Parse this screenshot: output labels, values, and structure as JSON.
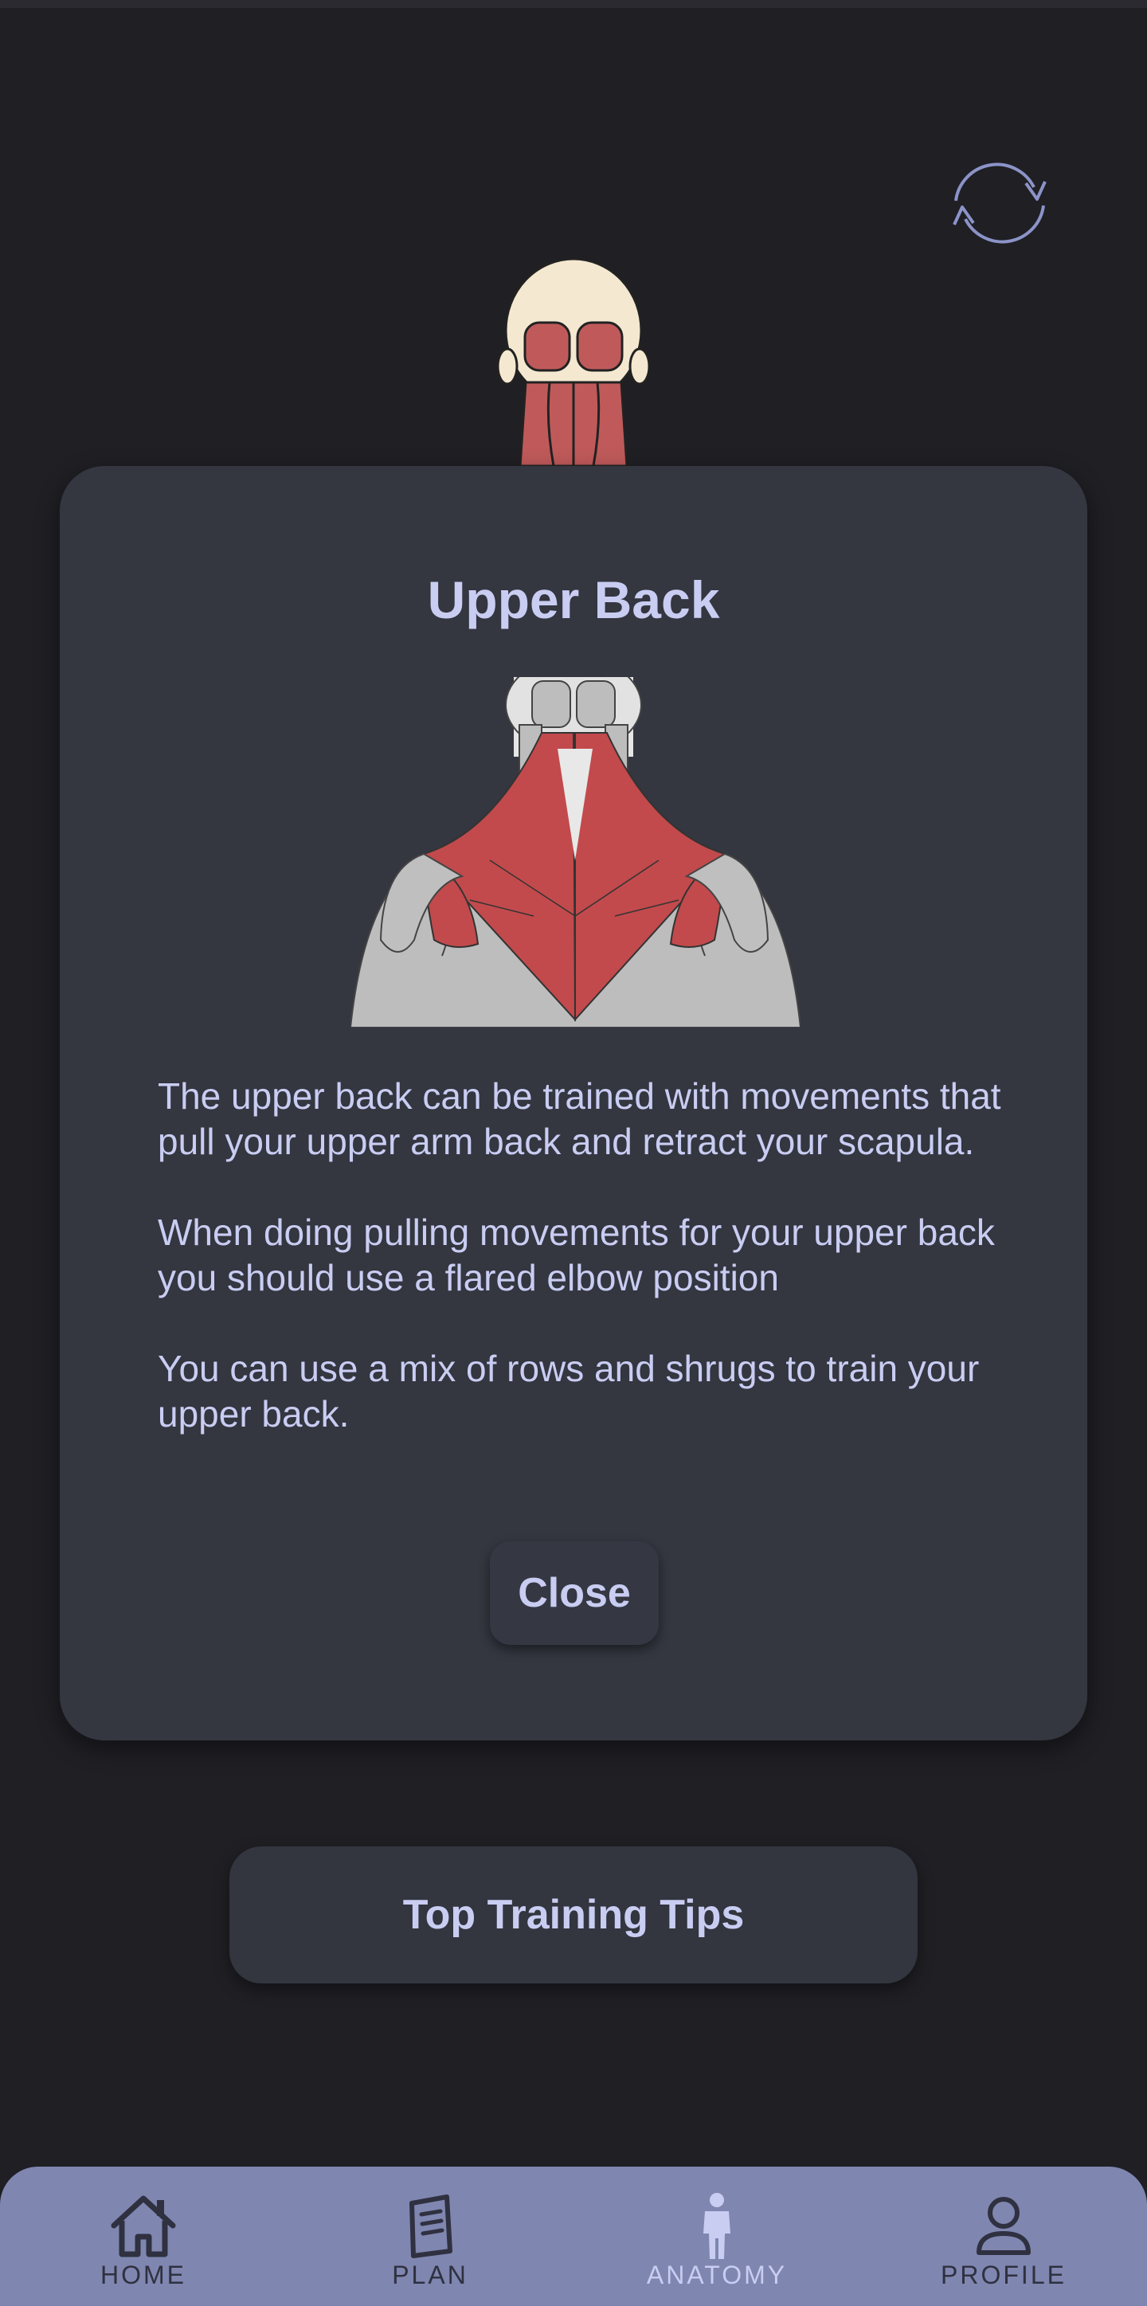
{
  "modal": {
    "title": "Upper Back",
    "paragraphs": [
      "The upper back can be trained with movements that pull your upper arm back and retract your scapula.",
      "When doing pulling movements for your upper back you should use a flared elbow position",
      "You can use a mix of rows and shrugs to train your upper back."
    ],
    "close_label": "Close"
  },
  "tips_button": {
    "label": "Top Training Tips"
  },
  "bottom_nav": {
    "items": [
      {
        "label": "HOME",
        "icon": "home-icon"
      },
      {
        "label": "PLAN",
        "icon": "notebook-icon"
      },
      {
        "label": "ANATOMY",
        "icon": "person-icon",
        "active": true
      },
      {
        "label": "PROFILE",
        "icon": "profile-icon"
      }
    ]
  },
  "colors": {
    "background": "#1f1f24",
    "modal": "#343640",
    "accent_text": "#c9cdf2",
    "nav_bar": "#7f86b0",
    "muscle_highlight": "#c24a4c"
  }
}
